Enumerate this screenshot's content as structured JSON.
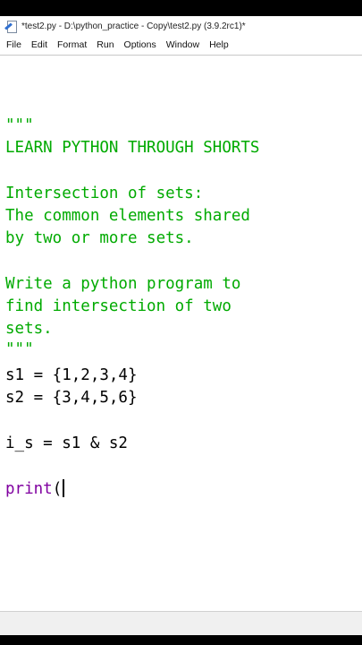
{
  "window": {
    "title": "*test2.py - D:\\python_practice - Copy\\test2.py (3.9.2rc1)*"
  },
  "menu": [
    "File",
    "Edit",
    "Format",
    "Run",
    "Options",
    "Window",
    "Help"
  ],
  "code": {
    "doc_open": "\"\"\"",
    "line_learn": "LEARN PYTHON THROUGH SHORTS",
    "line_topic": "Intersection of sets:",
    "line_desc1": "The common elements shared",
    "line_desc2": "by two or more sets.",
    "line_task1": "Write a python program to",
    "line_task2": "find intersection of two",
    "line_task3": "sets.",
    "doc_close": "\"\"\"",
    "line_s1": "s1 = {1,2,3,4}",
    "line_s2": "s2 = {3,4,5,6}",
    "line_is": "i_s = s1 & s2",
    "print_kw": "print",
    "print_paren": "("
  },
  "colors": {
    "string": "#00aa00",
    "builtin": "#8000a0",
    "text": "#000000"
  }
}
